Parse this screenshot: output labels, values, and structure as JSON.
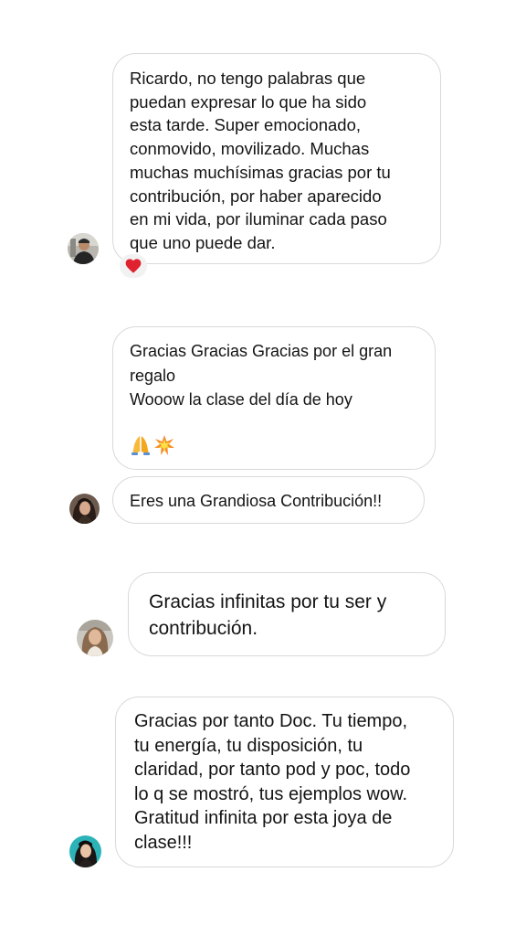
{
  "messages": [
    {
      "text": "Ricardo, no tengo palabras que\npuedan expresar lo que ha sido\nesta tarde. Super emocionado,\nconmovido, movilizado. Muchas\nmuchas muchísimas gracias por tu\ncontribución, por haber aparecido\nen mi vida, por iluminar cada paso\nque uno puede dar.",
      "reaction": "heart",
      "reaction_color": "#e0212f",
      "avatar": "avatar-man-dark-jacket"
    },
    {
      "text": "Gracias Gracias Gracias por el gran\nregalo\nWooow la clase del día de hoy",
      "emojis": [
        "folded-hands-icon",
        "collision-icon"
      ],
      "avatar": "avatar-woman-dark-hair"
    },
    {
      "text": "Eres una Grandiosa Contribución!!"
    },
    {
      "text": "Gracias infinitas por tu ser y\ncontribución.",
      "avatar": "avatar-woman-light-hair"
    },
    {
      "text": "Gracias por tanto Doc. Tu tiempo,\ntu energía, tu disposición, tu\nclaridad, por tanto pod y poc, todo\nlo q se mostró, tus ejemplos wow.\nGratitud infinita por esta joya de\nclase!!!",
      "avatar": "avatar-woman-teal-background"
    }
  ],
  "colors": {
    "bubble_border": "#d9d9d9",
    "text": "#141414",
    "reaction_background": "#f2f2f2"
  }
}
